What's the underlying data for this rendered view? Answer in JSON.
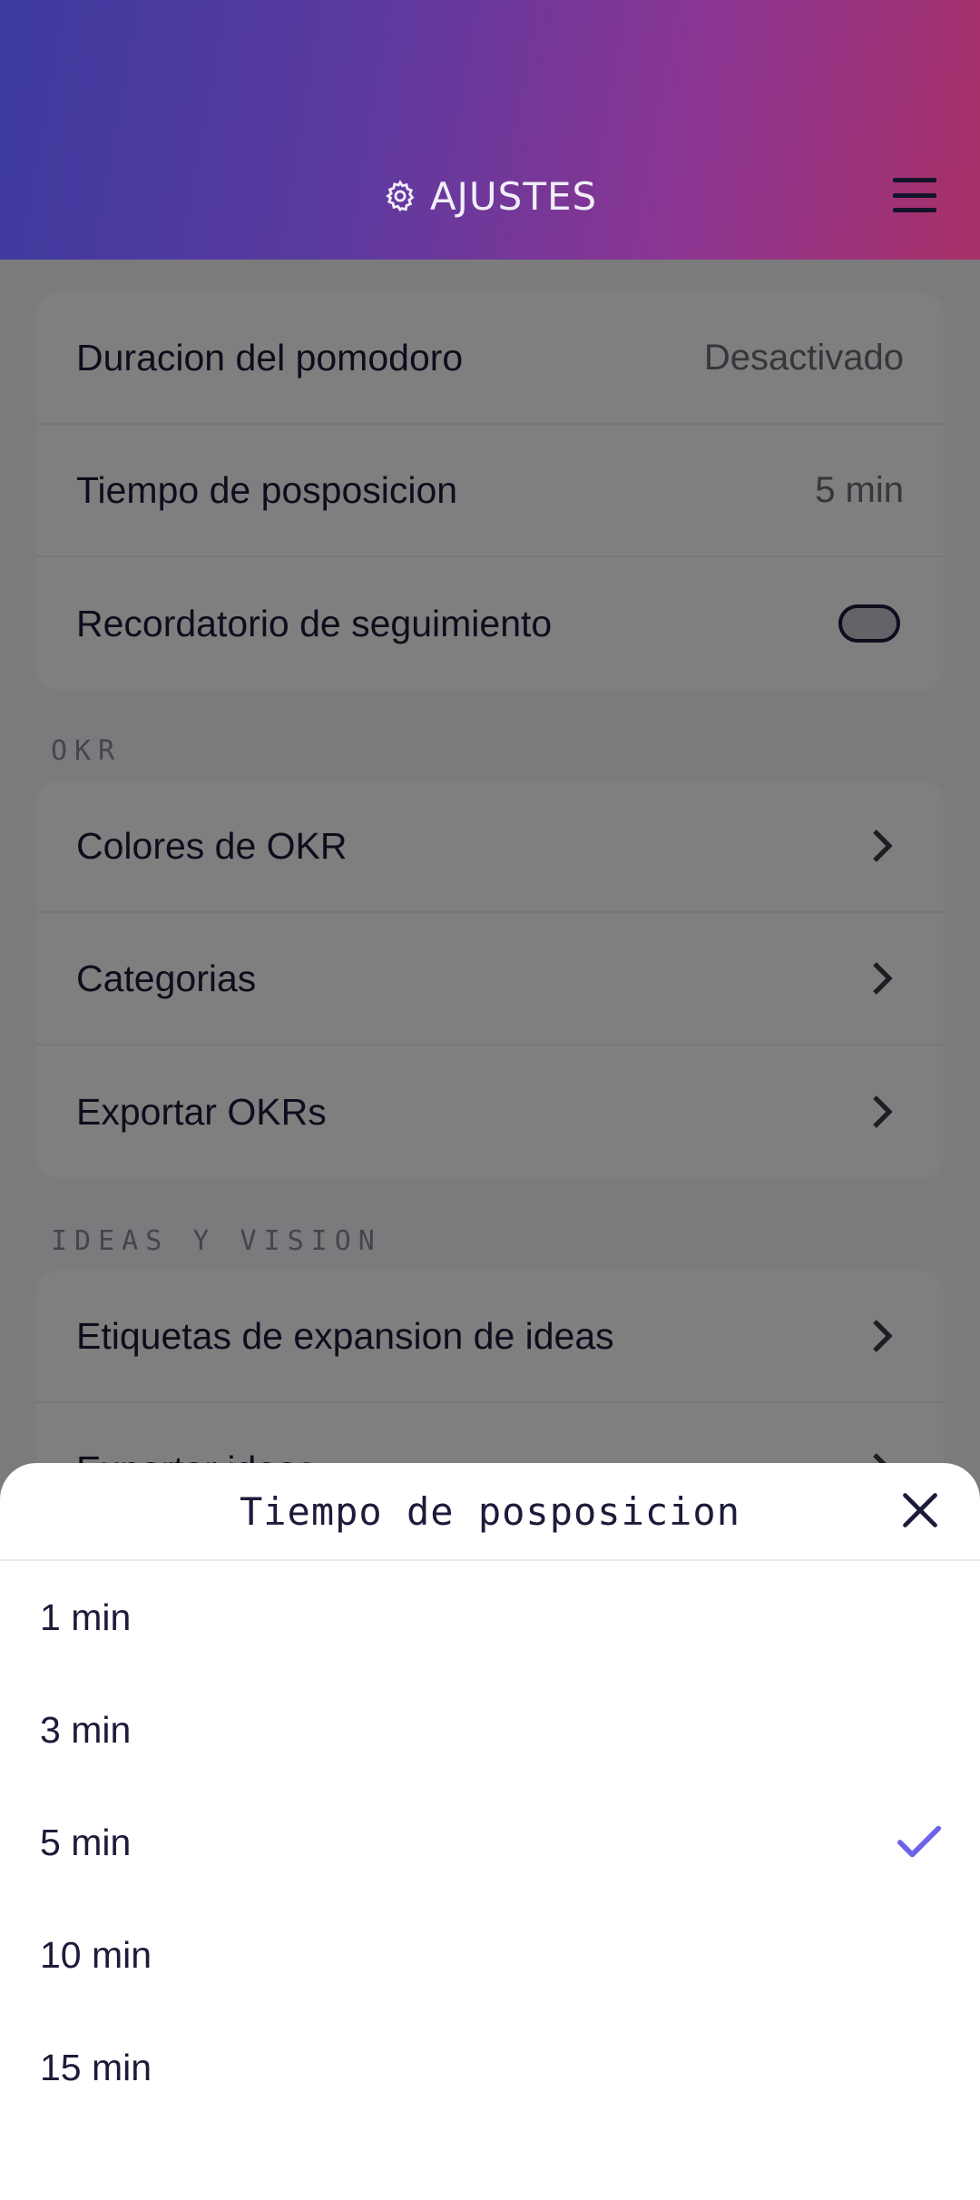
{
  "header": {
    "title": "AJUSTES",
    "icon": "gear-icon",
    "menu_icon": "hamburger-menu-icon",
    "gradient": [
      "#3c3a9e",
      "#a83068"
    ]
  },
  "settings": {
    "pomodoro": {
      "label": "Duracion del pomodoro",
      "value": "Desactivado"
    },
    "snooze": {
      "label": "Tiempo de posposicion",
      "value": "5 min"
    },
    "followup": {
      "label": "Recordatorio de seguimiento",
      "enabled": false
    }
  },
  "okr": {
    "section_label": "OKR",
    "items": [
      {
        "label": "Colores de OKR"
      },
      {
        "label": "Categorias"
      },
      {
        "label": "Exportar OKRs"
      }
    ]
  },
  "ideas": {
    "section_label": "IDEAS Y VISION",
    "items": [
      {
        "label": "Etiquetas de expansion de ideas"
      },
      {
        "label": "Exportar ideas"
      }
    ]
  },
  "sheet": {
    "title": "Tiempo de posposicion",
    "selected": "5 min",
    "accent": "#6b63e6",
    "options": [
      {
        "label": "1 min"
      },
      {
        "label": "3 min"
      },
      {
        "label": "5 min"
      },
      {
        "label": "10 min"
      },
      {
        "label": "15 min"
      }
    ]
  }
}
